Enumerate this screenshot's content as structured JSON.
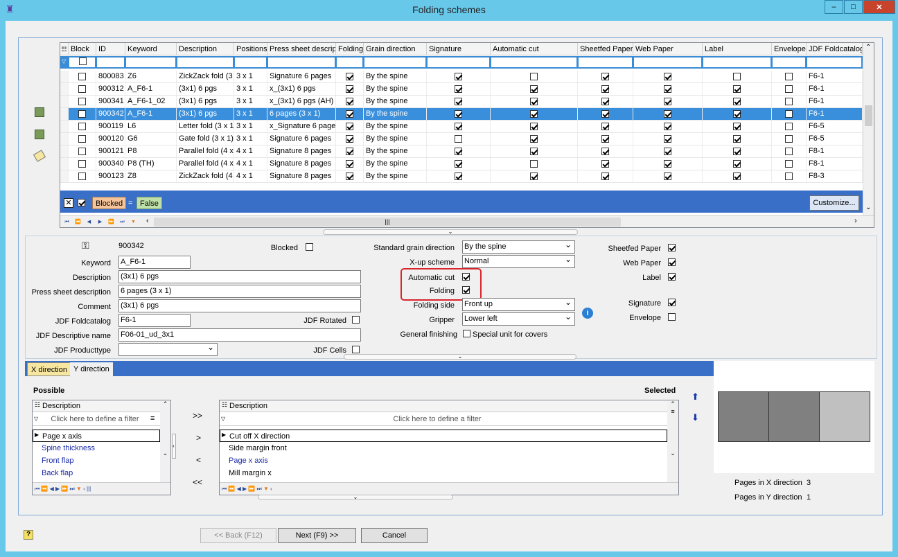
{
  "window": {
    "title": "Folding schemes",
    "btn_min": "–",
    "btn_max": "□",
    "btn_close": "✕"
  },
  "grid": {
    "columns": [
      "Block",
      "ID",
      "Keyword",
      "Description",
      "Positions",
      "Press sheet descrip",
      "Folding",
      "Grain direction",
      "Signature",
      "Automatic cut",
      "Sheetfed Paper",
      "Web Paper",
      "Label",
      "Envelope",
      "JDF Foldcatalog"
    ],
    "rows": [
      {
        "id": "800083",
        "keyword": "Z6",
        "desc": "ZickZack fold (3 :",
        "pos": "3 x 1",
        "press": "Signature 6 pages",
        "grain": "By the spine",
        "block": false,
        "folding": true,
        "sig": true,
        "auto": false,
        "sheet": true,
        "web": true,
        "label": false,
        "env": false,
        "jdf": "F6-1"
      },
      {
        "id": "900312",
        "keyword": "A_F6-1",
        "desc": "(3x1)  6 pgs",
        "pos": "3 x 1",
        "press": "x_(3x1)  6 pgs",
        "grain": "By the spine",
        "block": false,
        "folding": true,
        "sig": true,
        "auto": true,
        "sheet": true,
        "web": true,
        "label": true,
        "env": false,
        "jdf": "F6-1"
      },
      {
        "id": "900341",
        "keyword": "A_F6-1_02",
        "desc": "(3x1)  6 pgs",
        "pos": "3 x 1",
        "press": "x_(3x1)  6 pgs (AH)",
        "grain": "By the spine",
        "block": false,
        "folding": true,
        "sig": true,
        "auto": true,
        "sheet": true,
        "web": true,
        "label": true,
        "env": false,
        "jdf": "F6-1"
      },
      {
        "id": "900342",
        "keyword": "A_F6-1",
        "desc": "(3x1)  6 pgs",
        "pos": "3 x 1",
        "press": "6 pages (3 x 1)",
        "grain": "By the spine",
        "block": false,
        "folding": true,
        "sig": true,
        "auto": true,
        "sheet": true,
        "web": true,
        "label": true,
        "env": false,
        "jdf": "F6-1",
        "selected": true
      },
      {
        "id": "900119",
        "keyword": "L6",
        "desc": "Letter fold (3 x 1",
        "pos": "3 x 1",
        "press": "x_Signature 6 page",
        "grain": "By the spine",
        "block": false,
        "folding": true,
        "sig": true,
        "auto": true,
        "sheet": true,
        "web": true,
        "label": true,
        "env": false,
        "jdf": "F6-5"
      },
      {
        "id": "900120",
        "keyword": "G6",
        "desc": "Gate fold (3 x 1)",
        "pos": "3 x 1",
        "press": "Signature 6 pages",
        "grain": "By the spine",
        "block": false,
        "folding": true,
        "sig": false,
        "auto": true,
        "sheet": true,
        "web": true,
        "label": true,
        "env": false,
        "jdf": "F6-5"
      },
      {
        "id": "900121",
        "keyword": "P8",
        "desc": "Parallel fold (4 x",
        "pos": "4 x 1",
        "press": "Signature 8 pages",
        "grain": "By the spine",
        "block": false,
        "folding": true,
        "sig": true,
        "auto": true,
        "sheet": true,
        "web": true,
        "label": true,
        "env": false,
        "jdf": "F8-1"
      },
      {
        "id": "900340",
        "keyword": "P8 (TH)",
        "desc": "Parallel fold (4 x",
        "pos": "4 x 1",
        "press": "Signature 8 pages",
        "grain": "By the spine",
        "block": false,
        "folding": true,
        "sig": true,
        "auto": false,
        "sheet": true,
        "web": true,
        "label": true,
        "env": false,
        "jdf": "F8-1"
      },
      {
        "id": "900123",
        "keyword": "Z8",
        "desc": "ZickZack fold (4 :",
        "pos": "4 x 1",
        "press": "Signature 8 pages",
        "grain": "By the spine",
        "block": false,
        "folding": true,
        "sig": true,
        "auto": true,
        "sheet": true,
        "web": true,
        "label": true,
        "env": false,
        "jdf": "F8-3"
      }
    ],
    "filter_field": "Blocked",
    "filter_op": "=",
    "filter_value": "False",
    "customize": "Customize..."
  },
  "detail": {
    "id": "900342",
    "blocked_label": "Blocked",
    "keyword_label": "Keyword",
    "keyword": "A_F6-1",
    "desc_label": "Description",
    "desc": "(3x1)  6 pgs",
    "press_label": "Press sheet description",
    "press": "6 pages (3 x 1)",
    "comment_label": "Comment",
    "comment": "(3x1)  6 pgs",
    "jdf_label": "JDF Foldcatalog",
    "jdf": "F6-1",
    "jdf_rot_label": "JDF Rotated",
    "jdf_desc_label": "JDF Descriptive name",
    "jdf_desc": "F06-01_ud_3x1",
    "jdf_prod_label": "JDF Producttype",
    "jdf_prod": "",
    "jdf_cells_label": "JDF Cells",
    "grain_label": "Standard grain direction",
    "grain": "By the spine",
    "xup_label": "X-up scheme",
    "xup": "Normal",
    "autocut_label": "Automatic cut",
    "folding_label": "Folding",
    "foldside_label": "Folding side",
    "foldside": "Front up",
    "gripper_label": "Gripper",
    "gripper": "Lower left",
    "finishing_label": "General finishing",
    "special_label": "Special unit for covers",
    "sheetfed_label": "Sheetfed Paper",
    "web_label": "Web Paper",
    "label_label": "Label",
    "signature_label": "Signature",
    "envelope_label": "Envelope"
  },
  "tabs": {
    "x": "X direction",
    "y": "Y direction"
  },
  "possible": {
    "title": "Possible",
    "header": "Description",
    "filter": "Click here to define a filter",
    "items": [
      "Page x axis",
      "Spine thickness",
      "Front flap",
      "Back flap"
    ]
  },
  "selected": {
    "title": "Selected",
    "header": "Description",
    "filter": "Click here to define a filter",
    "items": [
      "Cut off X direction",
      "Side margin front",
      "Page x axis",
      "Mill margin x"
    ]
  },
  "move": {
    "all_right": ">>",
    "right": ">",
    "left": "<",
    "all_left": "<<"
  },
  "pages": {
    "x_label": "Pages in X direction",
    "x": "3",
    "y_label": "Pages in Y direction",
    "y": "1"
  },
  "buttons": {
    "back": "<< Back (F12)",
    "next": "Next (F9) >>",
    "cancel": "Cancel"
  }
}
